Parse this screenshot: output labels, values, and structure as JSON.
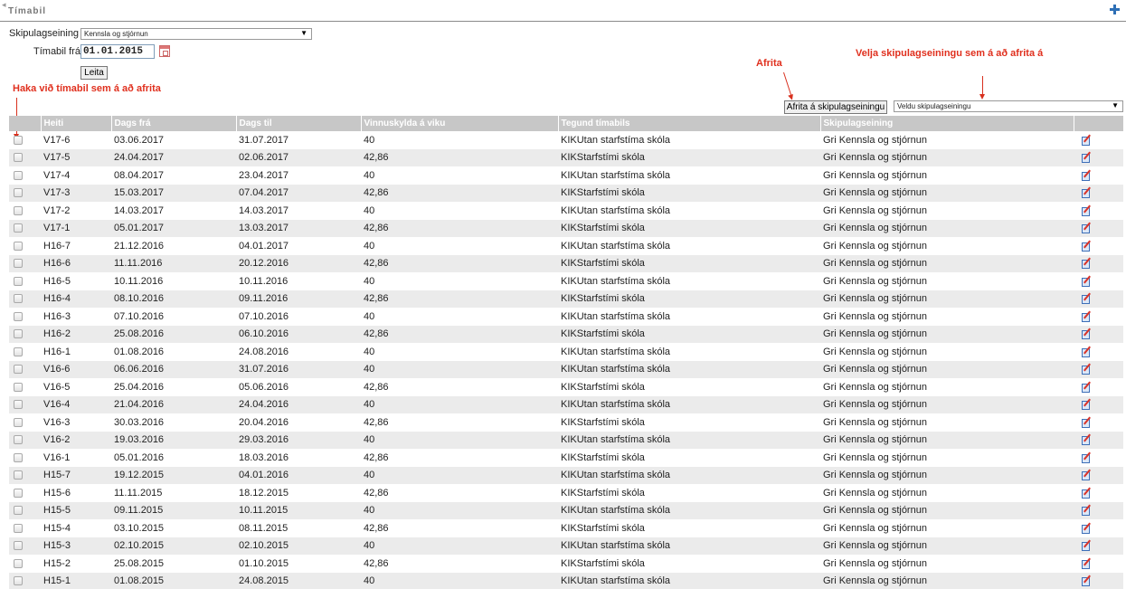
{
  "header": {
    "title": "Tímabil"
  },
  "filters": {
    "unit_label": "Skipulagseining",
    "unit_value": "Kennsla og stjórnun",
    "from_label": "Tímabil frá",
    "from_value": "01.01.2015",
    "search_button": "Leita"
  },
  "copy": {
    "button": "Afrita á skipulagseiningu",
    "target_select": "Veldu skipulagseiningu"
  },
  "annotations": {
    "check": "Haka við tímabil sem á að afrita",
    "copy": "Afrita",
    "select_unit": "Velja skipulagseiningu sem á að afrita á"
  },
  "table": {
    "columns": [
      "Heiti",
      "Dags frá",
      "Dags til",
      "Vinnuskylda á viku",
      "Tegund tímabils",
      "Skipulagseining"
    ],
    "rows": [
      [
        "V17-6",
        "03.06.2017",
        "31.07.2017",
        "40",
        "KIKUtan starfstíma skóla",
        "Gri Kennsla og stjórnun"
      ],
      [
        "V17-5",
        "24.04.2017",
        "02.06.2017",
        "42,86",
        "KIKStarfstími skóla",
        "Gri Kennsla og stjórnun"
      ],
      [
        "V17-4",
        "08.04.2017",
        "23.04.2017",
        "40",
        "KIKUtan starfstíma skóla",
        "Gri Kennsla og stjórnun"
      ],
      [
        "V17-3",
        "15.03.2017",
        "07.04.2017",
        "42,86",
        "KIKStarfstími skóla",
        "Gri Kennsla og stjórnun"
      ],
      [
        "V17-2",
        "14.03.2017",
        "14.03.2017",
        "40",
        "KIKUtan starfstíma skóla",
        "Gri Kennsla og stjórnun"
      ],
      [
        "V17-1",
        "05.01.2017",
        "13.03.2017",
        "42,86",
        "KIKStarfstími skóla",
        "Gri Kennsla og stjórnun"
      ],
      [
        "H16-7",
        "21.12.2016",
        "04.01.2017",
        "40",
        "KIKUtan starfstíma skóla",
        "Gri Kennsla og stjórnun"
      ],
      [
        "H16-6",
        "11.11.2016",
        "20.12.2016",
        "42,86",
        "KIKStarfstími skóla",
        "Gri Kennsla og stjórnun"
      ],
      [
        "H16-5",
        "10.11.2016",
        "10.11.2016",
        "40",
        "KIKUtan starfstíma skóla",
        "Gri Kennsla og stjórnun"
      ],
      [
        "H16-4",
        "08.10.2016",
        "09.11.2016",
        "42,86",
        "KIKStarfstími skóla",
        "Gri Kennsla og stjórnun"
      ],
      [
        "H16-3",
        "07.10.2016",
        "07.10.2016",
        "40",
        "KIKUtan starfstíma skóla",
        "Gri Kennsla og stjórnun"
      ],
      [
        "H16-2",
        "25.08.2016",
        "06.10.2016",
        "42,86",
        "KIKStarfstími skóla",
        "Gri Kennsla og stjórnun"
      ],
      [
        "H16-1",
        "01.08.2016",
        "24.08.2016",
        "40",
        "KIKUtan starfstíma skóla",
        "Gri Kennsla og stjórnun"
      ],
      [
        "V16-6",
        "06.06.2016",
        "31.07.2016",
        "40",
        "KIKUtan starfstíma skóla",
        "Gri Kennsla og stjórnun"
      ],
      [
        "V16-5",
        "25.04.2016",
        "05.06.2016",
        "42,86",
        "KIKStarfstími skóla",
        "Gri Kennsla og stjórnun"
      ],
      [
        "V16-4",
        "21.04.2016",
        "24.04.2016",
        "40",
        "KIKUtan starfstíma skóla",
        "Gri Kennsla og stjórnun"
      ],
      [
        "V16-3",
        "30.03.2016",
        "20.04.2016",
        "42,86",
        "KIKStarfstími skóla",
        "Gri Kennsla og stjórnun"
      ],
      [
        "V16-2",
        "19.03.2016",
        "29.03.2016",
        "40",
        "KIKUtan starfstíma skóla",
        "Gri Kennsla og stjórnun"
      ],
      [
        "V16-1",
        "05.01.2016",
        "18.03.2016",
        "42,86",
        "KIKStarfstími skóla",
        "Gri Kennsla og stjórnun"
      ],
      [
        "H15-7",
        "19.12.2015",
        "04.01.2016",
        "40",
        "KIKUtan starfstíma skóla",
        "Gri Kennsla og stjórnun"
      ],
      [
        "H15-6",
        "11.11.2015",
        "18.12.2015",
        "42,86",
        "KIKStarfstími skóla",
        "Gri Kennsla og stjórnun"
      ],
      [
        "H15-5",
        "09.11.2015",
        "10.11.2015",
        "40",
        "KIKUtan starfstíma skóla",
        "Gri Kennsla og stjórnun"
      ],
      [
        "H15-4",
        "03.10.2015",
        "08.11.2015",
        "42,86",
        "KIKStarfstími skóla",
        "Gri Kennsla og stjórnun"
      ],
      [
        "H15-3",
        "02.10.2015",
        "02.10.2015",
        "40",
        "KIKUtan starfstíma skóla",
        "Gri Kennsla og stjórnun"
      ],
      [
        "H15-2",
        "25.08.2015",
        "01.10.2015",
        "42,86",
        "KIKStarfstími skóla",
        "Gri Kennsla og stjórnun"
      ],
      [
        "H15-1",
        "01.08.2015",
        "24.08.2015",
        "40",
        "KIKUtan starfstíma skóla",
        "Gri Kennsla og stjórnun"
      ]
    ]
  },
  "icons": {
    "row_checkbox": "checkbox-icon",
    "row_edit": "edit-icon",
    "add": "plus-icon",
    "calendar": "calendar-icon"
  },
  "colors": {
    "annotation": "#e0301e",
    "header_bg": "#c7c7c7",
    "row_alt": "#ebebeb",
    "accent": "#2e6fb5"
  }
}
